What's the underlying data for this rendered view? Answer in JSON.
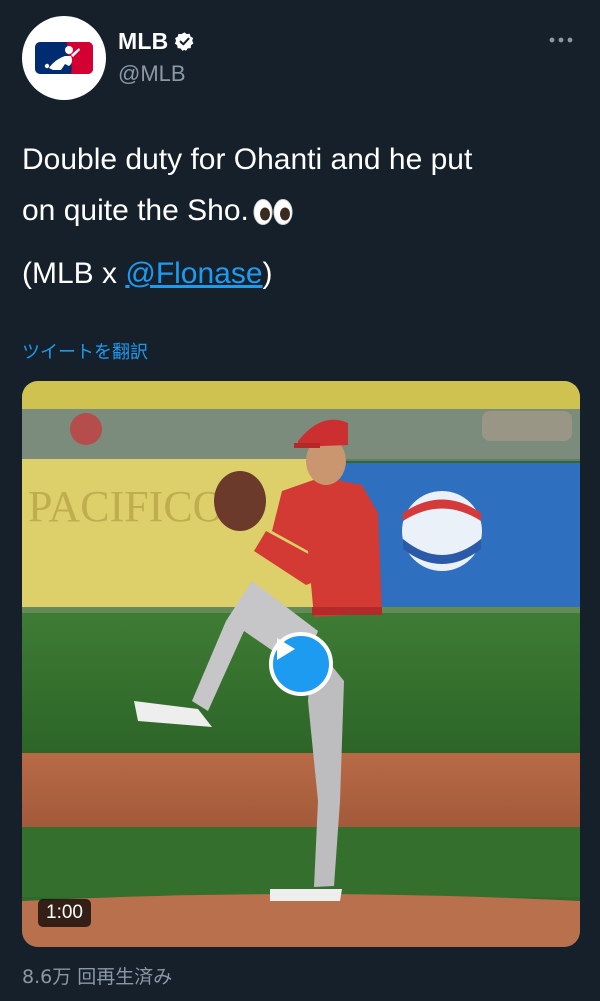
{
  "author": {
    "display_name": "MLB",
    "handle": "@MLB",
    "verified": true,
    "brand_colors": {
      "blue": "#002d72",
      "red": "#d50032"
    }
  },
  "tweet": {
    "text_line_1": "Double duty for Ohanti and he put",
    "text_line_2": "on quite the Sho.",
    "emoji": "eyes-icon",
    "credit_prefix": "(MLB x ",
    "credit_mention": "@Flonase",
    "credit_suffix": ")",
    "translate_label": "ツイートを翻訳"
  },
  "media": {
    "duration": "1:00",
    "play_icon": "play-icon"
  },
  "stats": {
    "views": "8.6万 回再生済み"
  },
  "theme": {
    "background": "#15202b",
    "link": "#1d9bf0",
    "secondary_text": "#8b98a5"
  }
}
